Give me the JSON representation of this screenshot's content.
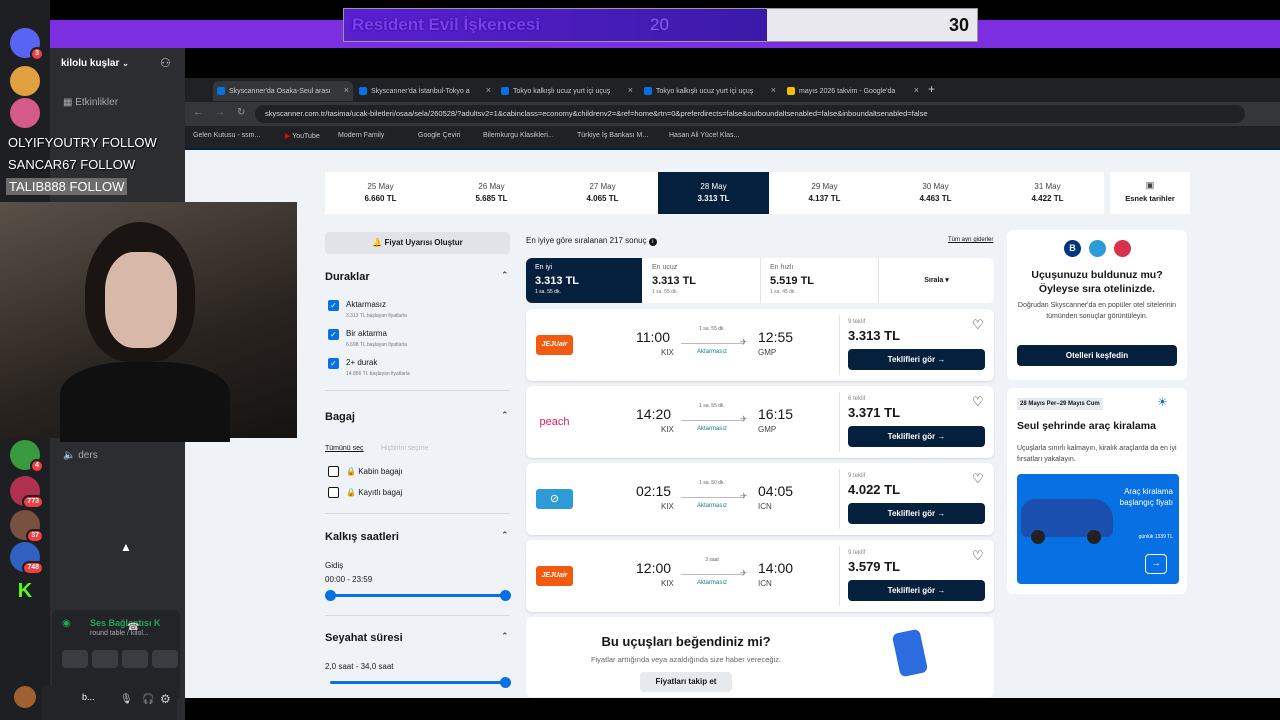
{
  "overlay": {
    "title": "Resident Evil İşkencesi",
    "left_score": "20",
    "right_score": "30",
    "left_fraction": 0.4
  },
  "discord": {
    "server_name": "kilolu kuşlar",
    "events_label": "Etkinlikler",
    "channel_voice": "ders",
    "follows": [
      "OLYIFYOUTRY  FOLLOW",
      "SANCAR67  FOLLOW",
      "TALIB888  FOLLOW"
    ],
    "badges": [
      "3",
      "4",
      "773",
      "37",
      "748"
    ],
    "voice_status": "Ses Bağlantısı K",
    "voice_sub": "round table / kilol...",
    "user_short": "b..."
  },
  "browser": {
    "tabs": [
      "Skyscanner'da Osaka-Seul arası",
      "Skyscanner'da İstanbul-Tokyo a",
      "Tokyo kalkışlı ucuz yurt içi uçuş",
      "Tokyo kalkışlı ucuz yurt içi uçuş",
      "mayıs 2026 takvim - Google'da"
    ],
    "url": "skyscanner.com.tr/tasima/ucak-biletleri/osaa/sela/260528/?adultsv2=1&cabinclass=economy&childrenv2=&ref=home&rtn=0&preferdirects=false&outboundaltsenabled=false&inboundaltsenabled=false",
    "bookmarks": [
      "Gelen Kutusu - ssm...",
      "YouTube",
      "Modern Family",
      "Google Çeviri",
      "Bilemkurgu Klasikleri...",
      "Türkiye İş Bankası M...",
      "Hasan Ali Yücel Klas..."
    ]
  },
  "dates": [
    {
      "day": "25 May",
      "price": "6.660 TL"
    },
    {
      "day": "26 May",
      "price": "5.685 TL"
    },
    {
      "day": "27 May",
      "price": "4.065 TL"
    },
    {
      "day": "28 May",
      "price": "3.313 TL"
    },
    {
      "day": "29 May",
      "price": "4.137 TL"
    },
    {
      "day": "30 May",
      "price": "4.463 TL"
    },
    {
      "day": "31 May",
      "price": "4.422 TL"
    }
  ],
  "flex_dates": "Esnek tarihler",
  "alert_button": "Fiyat Uyarısı Oluştur",
  "filters": {
    "stops_title": "Duraklar",
    "stops": [
      {
        "label": "Aktarmasız",
        "sub": "3.313 TL başlayan fiyatlarla"
      },
      {
        "label": "Bir aktarma",
        "sub": "6.698 TL başlayan fiyatlarla"
      },
      {
        "label": "2+ durak",
        "sub": "14.856 TL başlayan fiyatlarla"
      }
    ],
    "bag_title": "Bagaj",
    "select_all": "Tümünü seç",
    "clear_all": "Hiçbirini seçme",
    "bags": [
      "Kabin bagajı",
      "Kayıtlı bagaj"
    ],
    "dep_title": "Kalkış saatleri",
    "dep_sub": "Gidiş",
    "dep_range": "00:00 - 23:59",
    "dur_title": "Seyahat süresi",
    "dur_range": "2,0 saat - 34,0 saat"
  },
  "results_count": "En iyiye göre sıralanan 217 sonuç",
  "all_costs": "Tüm ayrı giderler",
  "sort_tabs": [
    {
      "label": "En iyi",
      "price": "3.313 TL",
      "sub": "1 sa. 55 dk."
    },
    {
      "label": "En ucuz",
      "price": "3.313 TL",
      "sub": "1 sa. 55 dk."
    },
    {
      "label": "En hızlı",
      "price": "5.519 TL",
      "sub": "1 sa. 45 dk."
    }
  ],
  "sort_label": "Sırala",
  "flights": [
    {
      "dep": "11:00",
      "dep_code": "KIX",
      "dur": "1 sa. 55 dk.",
      "stops": "Aktarmasız",
      "arr": "12:55",
      "arr_code": "GMP",
      "offers": "9 teklif",
      "price": "3.313 TL",
      "btn": "Teklifleri gör →",
      "airline": "jejuair"
    },
    {
      "dep": "14:20",
      "dep_code": "KIX",
      "dur": "1 sa. 55 dk.",
      "stops": "Aktarmasız",
      "arr": "16:15",
      "arr_code": "GMP",
      "offers": "6 teklif",
      "price": "3.371 TL",
      "btn": "Teklifleri gör →",
      "airline": "peach"
    },
    {
      "dep": "02:15",
      "dep_code": "KIX",
      "dur": "1 sa. 50 dk.",
      "stops": "Aktarmasız",
      "arr": "04:05",
      "arr_code": "ICN",
      "offers": "9 teklif",
      "price": "4.022 TL",
      "btn": "Teklifleri gör →",
      "airline": "other"
    },
    {
      "dep": "12:00",
      "dep_code": "KIX",
      "dur": "3 saat",
      "stops": "Aktarmasız",
      "arr": "14:00",
      "arr_code": "ICN",
      "offers": "9 teklif",
      "price": "3.579 TL",
      "btn": "Teklifleri gör →",
      "airline": "jejuair"
    }
  ],
  "airline_labels": {
    "jejuair": "JEJUair",
    "peach": "peach"
  },
  "like_box": {
    "title": "Bu uçuşları beğendiniz mi?",
    "sub": "Fiyatlar arttığında veya azaldığında size haber vereceğiz.",
    "btn": "Fiyatları takip et"
  },
  "hotel_ad": {
    "title": "Uçuşunuzu buldunuz mu? Öyleyse sıra otelinizde.",
    "sub": "Doğrudan Skyscanner'da en popüler otel sitelerinin tümünden sonuçlar görüntüleyin.",
    "btn": "Otelleri keşfedin"
  },
  "car_ad": {
    "dates": "28 Mayıs Per–29 Mayıs Cum",
    "title": "Seul şehrinde araç kiralama",
    "sub": "Uçuşlarla sınırlı kalmayın, kiralık araçlarda da en iyi fırsatları yakalayın.",
    "img_text": "Araç kiralama başlangıç fiyatı",
    "img_sub": "günlük 1339 TL"
  }
}
